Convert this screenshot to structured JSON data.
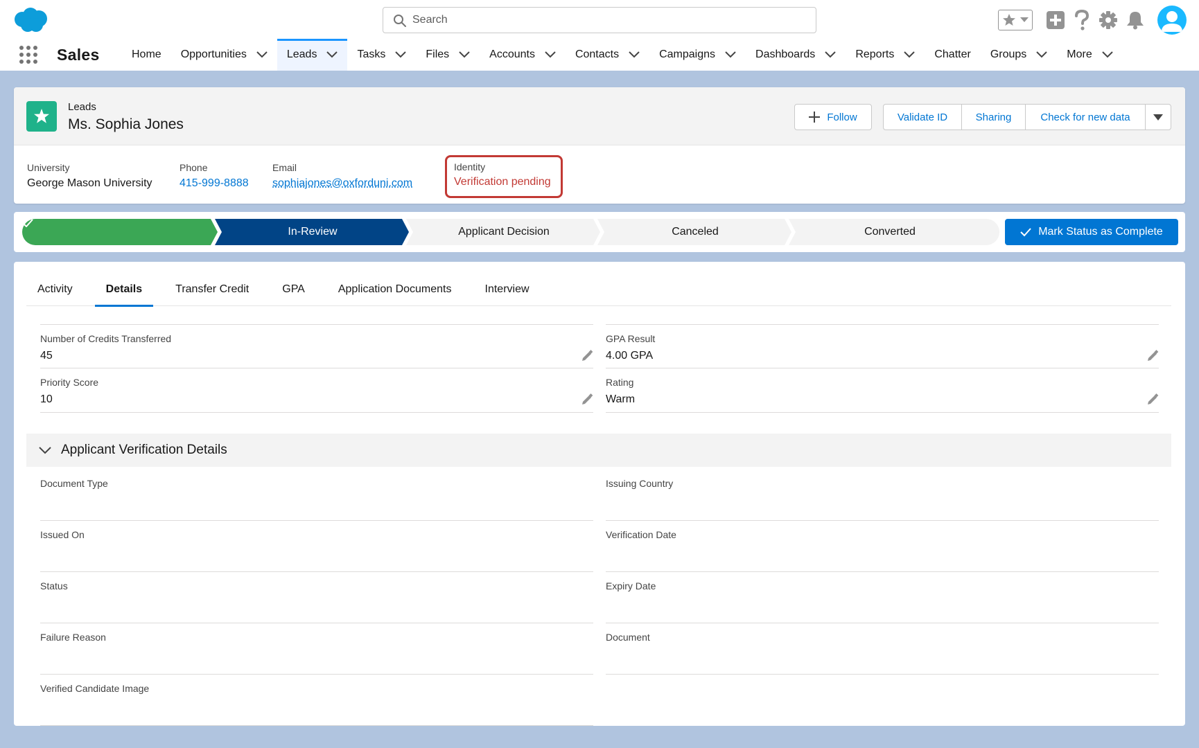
{
  "header": {
    "search_placeholder": "Search"
  },
  "nav": {
    "app_name": "Sales",
    "items": [
      {
        "label": "Home",
        "dropdown": false
      },
      {
        "label": "Opportunities",
        "dropdown": true
      },
      {
        "label": "Leads",
        "dropdown": true,
        "active": true
      },
      {
        "label": "Tasks",
        "dropdown": true
      },
      {
        "label": "Files",
        "dropdown": true
      },
      {
        "label": "Accounts",
        "dropdown": true
      },
      {
        "label": "Contacts",
        "dropdown": true
      },
      {
        "label": "Campaigns",
        "dropdown": true
      },
      {
        "label": "Dashboards",
        "dropdown": true
      },
      {
        "label": "Reports",
        "dropdown": true
      },
      {
        "label": "Chatter",
        "dropdown": false
      },
      {
        "label": "Groups",
        "dropdown": true
      },
      {
        "label": "More",
        "dropdown": true
      }
    ]
  },
  "record": {
    "object_label": "Leads",
    "name": "Ms. Sophia Jones",
    "buttons": {
      "follow": "Follow",
      "validate_id": "Validate ID",
      "sharing": "Sharing",
      "check_data": "Check for new data"
    },
    "highlights": {
      "university_label": "University",
      "university_value": "George Mason University",
      "phone_label": "Phone",
      "phone_value": "415-999-8888",
      "email_label": "Email",
      "email_value": "sophiajones@oxforduni.com",
      "identity_label": "Identity",
      "identity_value": "Verification pending"
    }
  },
  "path": {
    "stages": [
      "",
      "In-Review",
      "Applicant Decision",
      "Canceled",
      "Converted"
    ],
    "mark_button": "Mark Status as Complete",
    "colors": {
      "complete": "#3ba755",
      "current": "#014486",
      "incomplete": "#f3f3f3"
    }
  },
  "details": {
    "tabs": [
      "Activity",
      "Details",
      "Transfer Credit",
      "GPA",
      "Application Documents",
      "Interview"
    ],
    "fields": {
      "credits_label": "Number of Credits Transferred",
      "credits_value": "45",
      "gpa_label": "GPA Result",
      "gpa_value": "4.00 GPA",
      "priority_label": "Priority Score",
      "priority_value": "10",
      "rating_label": "Rating",
      "rating_value": "Warm"
    },
    "section": {
      "title": "Applicant Verification Details",
      "fields_left": [
        "Document Type",
        "Issued On",
        "Status",
        "Failure Reason",
        "Verified Candidate Image"
      ],
      "fields_right": [
        "Issuing Country",
        "Verification Date",
        "Expiry Date",
        "Document"
      ]
    }
  }
}
